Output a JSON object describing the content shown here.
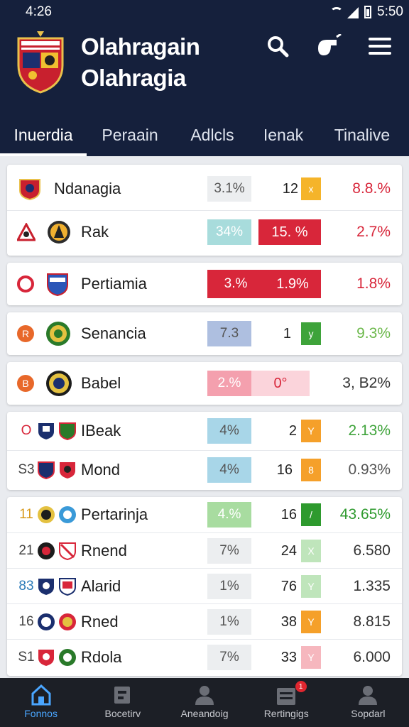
{
  "status_bar": {
    "time": "4:26",
    "right_time": "5:50"
  },
  "header": {
    "title_line1": "Olahragain",
    "title_line2": "Olahragia"
  },
  "tabs": [
    {
      "label": "Inuerdia"
    },
    {
      "label": "Peraain"
    },
    {
      "label": "Adlcls"
    },
    {
      "label": "Ienak"
    },
    {
      "label": "Tinalive"
    }
  ],
  "rows": [
    {
      "rank": "",
      "name": "Ndanagia",
      "pct1": "3.1%",
      "num": "12",
      "mark": "x",
      "pct2": "8.8.%"
    },
    {
      "rank": "",
      "name": "Rak",
      "pct1": "34%",
      "num": "15. %",
      "mark": "",
      "pct2": "2.7%"
    },
    {
      "rank": "",
      "name": "Pertiamia",
      "pct1": "3.%",
      "num": "1.9%",
      "mark": "",
      "pct2": "1.8%"
    },
    {
      "rank": "R",
      "name": "Senancia",
      "pct1": "7.3",
      "num": "1",
      "mark": "y",
      "pct2": "9.3%"
    },
    {
      "rank": "B",
      "name": "Babel",
      "pct1": "2.%",
      "num": "0°",
      "mark": "",
      "pct2": "3, B2%"
    },
    {
      "rank": "O",
      "name": "IBeak",
      "pct1": "4%",
      "num": "2",
      "mark": "Y",
      "pct2": "2.13%"
    },
    {
      "rank": "S3",
      "name": "Mond",
      "pct1": "4%",
      "num": "16",
      "mark": "8",
      "pct2": "0.93%"
    },
    {
      "rank": "11",
      "name": "Pertarinja",
      "pct1": "4.%",
      "num": "16",
      "mark": "/",
      "pct2": "43.65%"
    },
    {
      "rank": "21",
      "name": "Rnend",
      "pct1": "7%",
      "num": "24",
      "mark": "X",
      "pct2": "6.580"
    },
    {
      "rank": "83",
      "name": "Alarid",
      "pct1": "1%",
      "num": "76",
      "mark": "Y",
      "pct2": "1.335"
    },
    {
      "rank": "16",
      "name": "Rned",
      "pct1": "1%",
      "num": "38",
      "mark": "Y",
      "pct2": "8.815"
    },
    {
      "rank": "S1",
      "name": "Rdola",
      "pct1": "7%",
      "num": "33",
      "mark": "Y",
      "pct2": "6.000"
    }
  ],
  "bottom_nav": [
    {
      "label": "Fonnos",
      "icon": "home-icon"
    },
    {
      "label": "Bocetirv",
      "icon": "cards-icon"
    },
    {
      "label": "Aneandoig",
      "icon": "user-icon"
    },
    {
      "label": "Rertingigs",
      "icon": "stats-icon",
      "badge": "1"
    },
    {
      "label": "Sopdarl",
      "icon": "profile-icon"
    }
  ],
  "colors": {
    "header_bg": "#15203c",
    "red": "#d8263a",
    "green": "#3ea33a",
    "orange": "#f5a02a",
    "blue_light": "#a8d6e8",
    "nav_active": "#4aa6ff"
  }
}
